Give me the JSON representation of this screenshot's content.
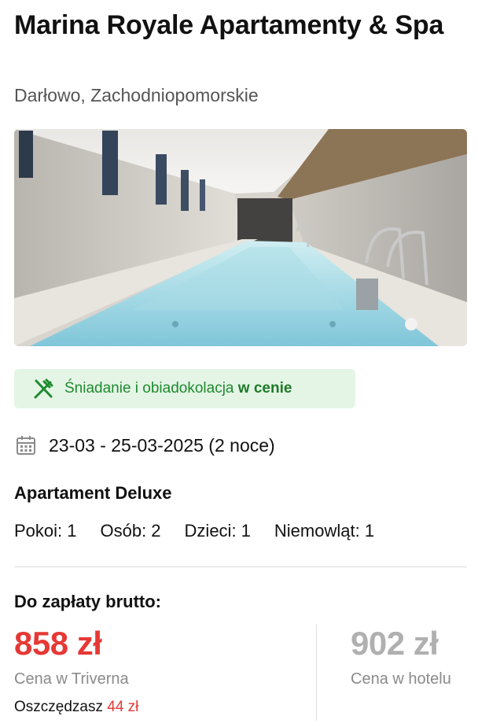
{
  "hotel": {
    "name": "Marina Royale Apartamenty & Spa",
    "location": "Darłowo, Zachodniopomorskie"
  },
  "meal": {
    "text": "Śniadanie i obiadokolacja",
    "highlight": "w cenie",
    "icon": "cutlery-icon"
  },
  "stay": {
    "dates": "23-03 - 25-03-2025 (2 noce)",
    "icon": "calendar-icon"
  },
  "room": {
    "type": "Apartament Deluxe",
    "rooms": "Pokoi: 1",
    "adults": "Osób: 2",
    "children": "Dzieci: 1",
    "infants": "Niemowląt: 1"
  },
  "payment": {
    "label": "Do zapłaty brutto:",
    "price": "858 zł",
    "price_label": "Cena w Triverna",
    "savings_label": "Oszczędzasz",
    "savings_amount": "44 zł",
    "hotel_price": "902 zł",
    "hotel_price_label": "Cena w hotelu"
  },
  "colors": {
    "accent_red": "#e53935",
    "badge_green_bg": "#e4f5e6",
    "badge_green_text": "#1f8a2e"
  }
}
